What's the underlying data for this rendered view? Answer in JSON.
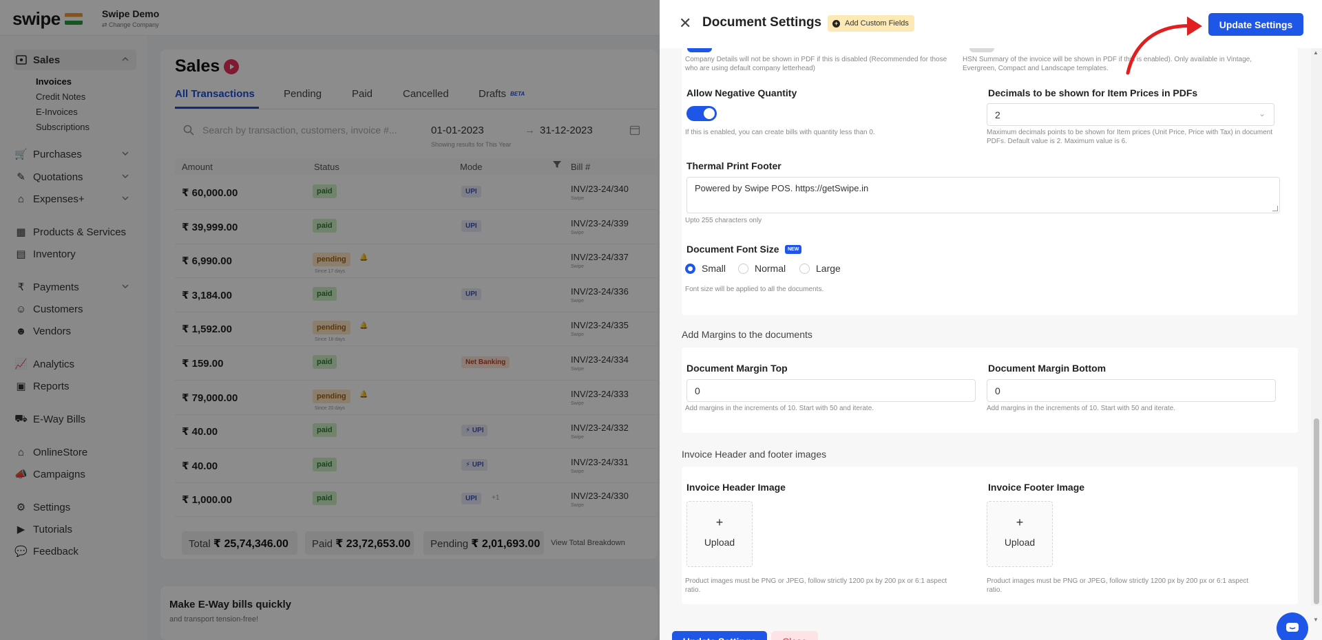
{
  "brand": {
    "logo": "swipe",
    "company": "Swipe Demo",
    "company_sub": "⇄ Change Company"
  },
  "sidebar": {
    "sales_label": "Sales",
    "sales_sub": [
      "Invoices",
      "Credit Notes",
      "E-Invoices",
      "Subscriptions"
    ],
    "items": [
      "Purchases",
      "Quotations",
      "Expenses+",
      "Products & Services",
      "Inventory",
      "Payments",
      "Customers",
      "Vendors",
      "Analytics",
      "Reports",
      "E-Way Bills",
      "OnlineStore",
      "Campaigns",
      "Settings",
      "Tutorials",
      "Feedback"
    ]
  },
  "sales": {
    "title": "Sales",
    "tabs": [
      "All Transactions",
      "Pending",
      "Paid",
      "Cancelled",
      "Drafts"
    ],
    "beta": "BETA",
    "search_placeholder": "Search by transaction, customers, invoice #...",
    "date_from": "01-01-2023",
    "date_to": "31-12-2023",
    "date_note": "Showing results for This Year",
    "columns": [
      "Amount",
      "Status",
      "Mode",
      "Bill #"
    ],
    "rows": [
      {
        "amount": "₹ 60,000.00",
        "status": "paid",
        "due": "",
        "mode": "UPI",
        "bill": "INV/23-24/340",
        "bill_sub": "Swipe"
      },
      {
        "amount": "₹ 39,999.00",
        "status": "paid",
        "due": "",
        "mode": "UPI",
        "bill": "INV/23-24/339",
        "bill_sub": "Swipe"
      },
      {
        "amount": "₹ 6,990.00",
        "status": "pending",
        "due": "Since 17 days",
        "mode": "",
        "bill": "INV/23-24/337",
        "bill_sub": "Swipe"
      },
      {
        "amount": "₹ 3,184.00",
        "status": "paid",
        "due": "",
        "mode": "UPI",
        "bill": "INV/23-24/336",
        "bill_sub": "Swipe"
      },
      {
        "amount": "₹ 1,592.00",
        "status": "pending",
        "due": "Since 18 days",
        "mode": "",
        "bill": "INV/23-24/335",
        "bill_sub": "Swipe"
      },
      {
        "amount": "₹ 159.00",
        "status": "paid",
        "due": "",
        "mode": "Net Banking",
        "bill": "INV/23-24/334",
        "bill_sub": "Swipe"
      },
      {
        "amount": "₹ 79,000.00",
        "status": "pending",
        "due": "Since 20 days",
        "mode": "",
        "bill": "INV/23-24/333",
        "bill_sub": "Swipe"
      },
      {
        "amount": "₹ 40.00",
        "status": "paid",
        "due": "",
        "mode": "⚡ UPI",
        "bill": "INV/23-24/332",
        "bill_sub": "Swipe"
      },
      {
        "amount": "₹ 40.00",
        "status": "paid",
        "due": "",
        "mode": "⚡ UPI",
        "bill": "INV/23-24/331",
        "bill_sub": "Swipe"
      },
      {
        "amount": "₹ 1,000.00",
        "status": "paid",
        "due": "",
        "mode": "UPI",
        "bill": "INV/23-24/330",
        "bill_sub": "Swipe",
        "extra": "+1"
      }
    ],
    "total_label": "Total",
    "total_value": "₹ 25,74,346.00",
    "paid_label": "Paid",
    "paid_value": "₹ 23,72,653.00",
    "pending_label": "Pending",
    "pending_value": "₹ 2,01,693.00",
    "view_breakdown": "View Total Breakdown",
    "eway_title": "Make E-Way bills quickly",
    "eway_sub": "and transport tension-free!"
  },
  "drawer": {
    "title": "Document Settings",
    "custom_fields": "Add Custom Fields",
    "update_label": "Update Settings",
    "close_label": "Close",
    "company_help": "Company Details will not be shown in PDF if this is disabled (Recommended for those who are using default company letterhead)",
    "hsn_help": "HSN Summary of the invoice will be shown in PDF if this is enabled). Only available in Vintage, Evergreen, Compact and Landscape templates.",
    "neg_qty_label": "Allow Negative Quantity",
    "neg_qty_help": "If this is enabled, you can create bills with quantity less than 0.",
    "neg_qty_enabled": true,
    "decimals_label": "Decimals to be shown for Item Prices in PDFs",
    "decimals_value": "2",
    "decimals_help": "Maximum decimals points to be shown for Item prices (Unit Price, Price with Tax) in document PDFs. Default value is 2. Maximum value is 6.",
    "footer_label": "Thermal Print Footer",
    "footer_value": "Powered by Swipe POS. https://getSwipe.in",
    "footer_help": "Upto 255 characters only",
    "font_label": "Document Font Size",
    "new_badge": "NEW",
    "font_options": [
      "Small",
      "Normal",
      "Large"
    ],
    "font_selected": "Small",
    "font_help": "Font size will be applied to all the documents.",
    "margins_title": "Add Margins to the documents",
    "margin_top_label": "Document Margin Top",
    "margin_top_value": "0",
    "margin_bottom_label": "Document Margin Bottom",
    "margin_bottom_value": "0",
    "margin_help": "Add margins in the increments of 10. Start with 50 and iterate.",
    "images_title": "Invoice Header and footer images",
    "header_img_label": "Invoice Header Image",
    "footer_img_label": "Invoice Footer Image",
    "upload_plus": "+",
    "upload_label": "Upload",
    "image_help": "Product images must be PNG or JPEG, follow strictly 1200 px by 200 px or 6:1 aspect ratio."
  },
  "colors": {
    "primary": "#1e56e8",
    "annotation_arrow": "#e02020",
    "paid": "#2e7d32",
    "pending": "#a4630f"
  }
}
